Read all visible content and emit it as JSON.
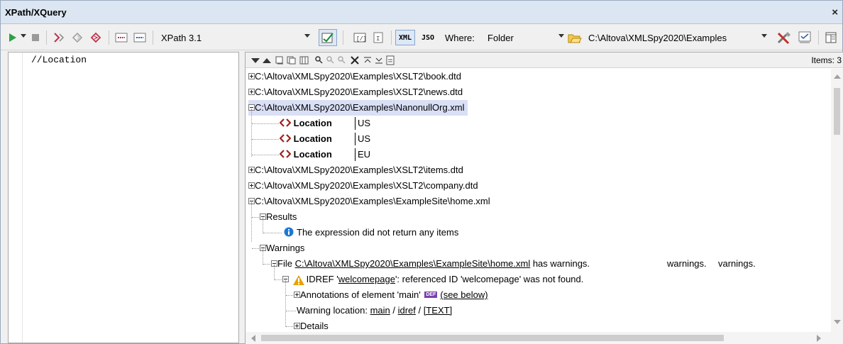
{
  "window": {
    "title": "XPath/XQuery",
    "close_glyph": "×"
  },
  "toolbar": {
    "xpath_version": "XPath 3.1",
    "xml_label": "XML",
    "json_label": "JSO",
    "where_label": "Where:",
    "where_value": "Folder",
    "folder_path": "C:\\Altova\\XMLSpy2020\\Examples",
    "icons": [
      "run-icon",
      "run-dropdown-icon",
      "stop-icon",
      "xpath-builder-icon",
      "xpath-evaluate-icon",
      "xpath-step-icon",
      "comment-icon",
      "uncomment-icon",
      "validate-icon",
      "xml-mode-icon",
      "json-mode-icon",
      "open-folder-icon",
      "settings-icon",
      "results-icon",
      "layout-icon"
    ]
  },
  "editor": {
    "expression": "//Location"
  },
  "results": {
    "items_count": "Items: 3",
    "tree": {
      "file1": "C:\\Altova\\XMLSpy2020\\Examples\\XSLT2\\book.dtd",
      "file2": "C:\\Altova\\XMLSpy2020\\Examples\\XSLT2\\news.dtd",
      "file3": "C:\\Altova\\XMLSpy2020\\Examples\\NanonullOrg.xml",
      "locations": [
        {
          "name": "Location",
          "value": "US"
        },
        {
          "name": "Location",
          "value": "US"
        },
        {
          "name": "Location",
          "value": "EU"
        }
      ],
      "file4": "C:\\Altova\\XMLSpy2020\\Examples\\XSLT2\\items.dtd",
      "file5": "C:\\Altova\\XMLSpy2020\\Examples\\XSLT2\\company.dtd",
      "file6": "C:\\Altova\\XMLSpy2020\\Examples\\ExampleSite\\home.xml",
      "results_label": "Results",
      "no_items": "The expression did not return any items",
      "warnings_label": "Warnings",
      "warn_file_prefix": "File ",
      "warn_file_link": "C:\\Altova\\XMLSpy2020\\Examples\\ExampleSite\\home.xml",
      "warn_file_suffix": " has warnings.",
      "warn_ghost_1": "warnings.",
      "warn_ghost_2": "varnings.",
      "idref_prefix": "IDREF '",
      "idref_link": "welcomepage",
      "idref_suffix": "': referenced ID 'welcomepage' was not found.",
      "annotations_text": "Annotations of element 'main'",
      "annotations_badge": "DEF",
      "see_below": "(see below)",
      "warn_loc_prefix": "Warning location: ",
      "warn_loc_main": "main",
      "warn_loc_sep1": " / ",
      "warn_loc_idref": "idref",
      "warn_loc_sep2": " / ",
      "warn_loc_text": "[TEXT]",
      "details_label": "Details"
    }
  },
  "colors": {
    "title_bg": "#dce6f2",
    "selection": "#d9dff5",
    "element_icon": "#a02020",
    "info_icon": "#1e78d2",
    "warning_icon": "#e8a200"
  }
}
